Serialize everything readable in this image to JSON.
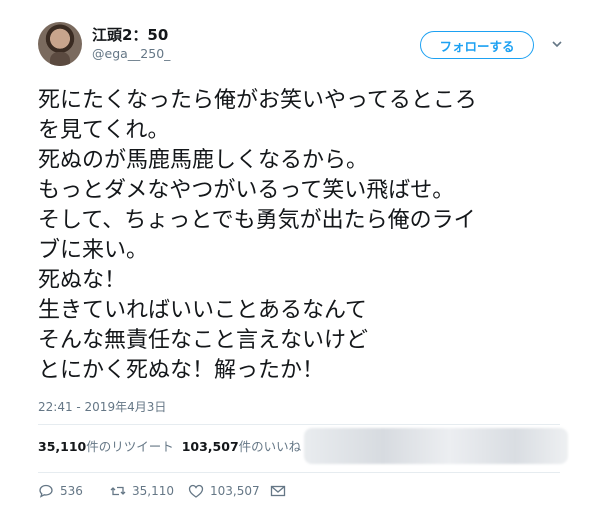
{
  "user": {
    "name": "江頭2：50",
    "handle": "@ega__250_",
    "follow_label": "フォローする"
  },
  "tweet": {
    "lines": [
      "死にたくなったら俺がお笑いやってるところ",
      "を見てくれ。",
      "死ぬのが馬鹿馬鹿しくなるから。",
      "もっとダメなやつがいるって笑い飛ばせ。",
      "そして、ちょっとでも勇気が出たら俺のライ",
      "ブに来い。",
      "死ぬな！",
      "生きていればいいことあるなんて",
      "そんな無責任なこと言えないけど",
      "とにかく死ぬな！解ったか！"
    ],
    "timestamp": "22:41 - 2019年4月3日"
  },
  "stats": {
    "retweets_count": "35,110",
    "retweets_label": "件のリツイート",
    "likes_count": "103,507",
    "likes_label": "件のいいね"
  },
  "actions": {
    "replies": "536",
    "retweets": "35,110",
    "likes": "103,507"
  },
  "icons": {
    "reply": "reply-icon",
    "retweet": "retweet-icon",
    "like": "heart-icon",
    "share": "envelope-icon",
    "menu": "chevron-down-icon"
  },
  "colors": {
    "accent": "#1da1f2",
    "text": "#14171a",
    "muted": "#657786"
  }
}
